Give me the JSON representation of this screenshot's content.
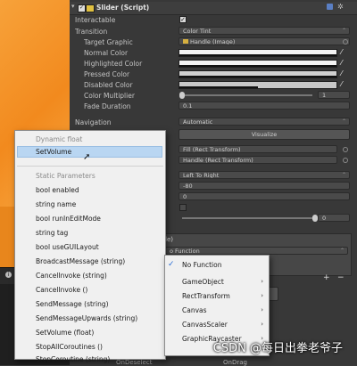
{
  "component": {
    "title": "Slider (Script)",
    "interactable_label": "Interactable",
    "transition_label": "Transition",
    "transition_value": "Color Tint",
    "target_graphic_label": "Target Graphic",
    "target_graphic_value": "Handle (Image)",
    "normal_color_label": "Normal Color",
    "highlighted_color_label": "Highlighted Color",
    "pressed_color_label": "Pressed Color",
    "disabled_color_label": "Disabled Color",
    "color_multiplier_label": "Color Multiplier",
    "color_multiplier_value": "1",
    "color_multiplier_fraction": 1.0,
    "fade_duration_label": "Fade Duration",
    "fade_duration_value": "0.1",
    "navigation_label": "Navigation",
    "navigation_value": "Automatic",
    "visualize_label": "Visualize",
    "fill_rect_value": "Fill (Rect Transform)",
    "handle_rect_value": "Handle (Rect Transform)",
    "direction_value": "Left To Right",
    "min_value": "-80",
    "max_value": "0",
    "slider_value": "0",
    "slider_fraction": 0.0,
    "onvalue_title_fragment": "le)",
    "onvalue_function_fragment": "o Function",
    "plus_label": "+",
    "minus_label": "−",
    "bottom_left_label": "OnDeselect",
    "bottom_right_label": "OnDrag"
  },
  "popup_menu": {
    "dynamic_header": "Dynamic float",
    "dynamic_items": [
      "SetVolume"
    ],
    "static_header": "Static Parameters",
    "static_items": [
      "bool enabled",
      "string name",
      "bool runInEditMode",
      "string tag",
      "bool useGUILayout",
      "BroadcastMessage (string)",
      "CancelInvoke (string)",
      "CancelInvoke ()",
      "SendMessage (string)",
      "SendMessageUpwards (string)",
      "SetVolume (float)",
      "StopAllCoroutines ()",
      "StopCoroutine (string)"
    ]
  },
  "submenu": {
    "items": [
      {
        "label": "No Function",
        "checked": true,
        "has_arrow": false
      },
      {
        "label": "GameObject",
        "checked": false,
        "has_arrow": true
      },
      {
        "label": "RectTransform",
        "checked": false,
        "has_arrow": true
      },
      {
        "label": "Canvas",
        "checked": false,
        "has_arrow": true
      },
      {
        "label": "CanvasScaler",
        "checked": false,
        "has_arrow": true
      },
      {
        "label": "GraphicRaycaster",
        "checked": false,
        "has_arrow": true
      }
    ]
  },
  "watermark": "CSDN @每日出拳老爷子",
  "colors": {
    "scene_orange": "#f28a1e",
    "inspector_bg": "#383838",
    "highlight": "#b9d6f2"
  }
}
